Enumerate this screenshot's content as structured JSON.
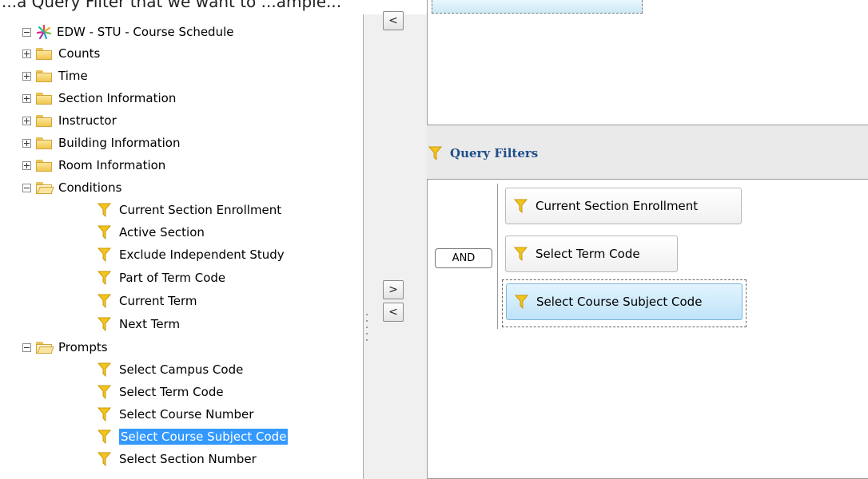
{
  "top_caption": "...a Query Filter that we want to ...ample...",
  "tree": {
    "root": {
      "label": "EDW - STU - Course Schedule"
    },
    "folders": [
      {
        "label": "Counts"
      },
      {
        "label": "Time"
      },
      {
        "label": "Section Information"
      },
      {
        "label": "Instructor"
      },
      {
        "label": "Building Information"
      },
      {
        "label": "Room Information"
      }
    ],
    "conditions": {
      "label": "Conditions",
      "items": [
        {
          "label": "Current Section Enrollment"
        },
        {
          "label": "Active Section"
        },
        {
          "label": "Exclude Independent Study"
        },
        {
          "label": "Part of Term Code"
        },
        {
          "label": "Current Term"
        },
        {
          "label": "Next Term"
        }
      ]
    },
    "prompts": {
      "label": "Prompts",
      "items": [
        {
          "label": "Select Campus Code"
        },
        {
          "label": "Select Term Code"
        },
        {
          "label": "Select Course Number"
        },
        {
          "label": "Select Course Subject Code",
          "selected": true
        },
        {
          "label": "Select Section Number"
        }
      ]
    }
  },
  "buttons": {
    "remove_object": "<",
    "add_filter": ">",
    "remove_filter": "<"
  },
  "query_filters": {
    "title": "Query Filters",
    "operator": "AND",
    "filters": [
      {
        "label": "Current Section Enrollment"
      },
      {
        "label": "Select Term Code"
      },
      {
        "label": "Select Course Subject Code",
        "selected": true
      }
    ]
  },
  "colors": {
    "funnel": "#f4c41e",
    "selection": "#3399ff",
    "header_text": "#1f4e8c"
  }
}
